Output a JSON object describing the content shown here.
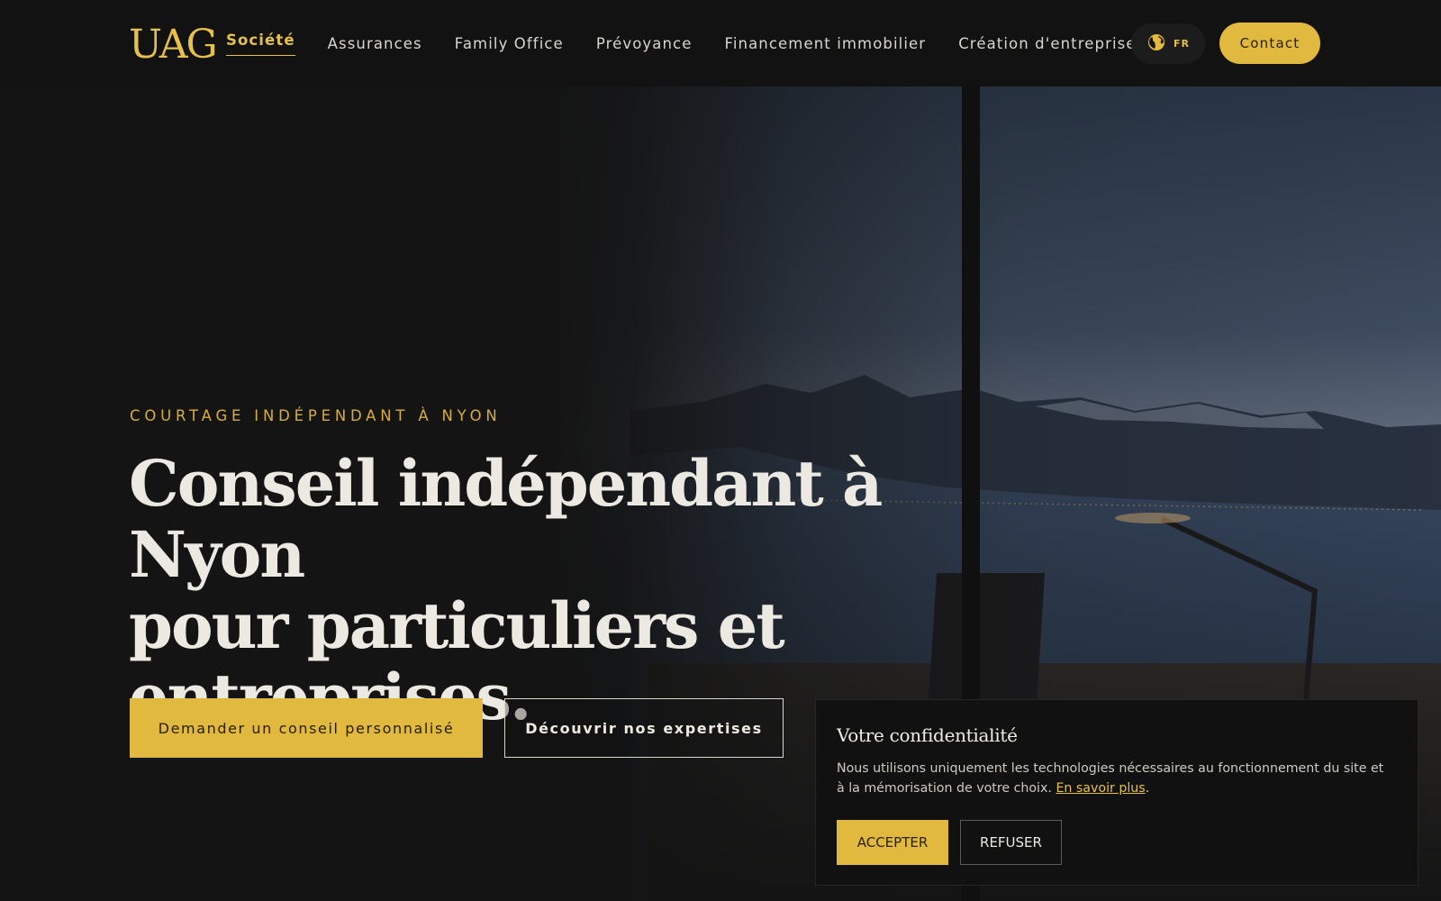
{
  "header": {
    "logo": "UAG",
    "nav": [
      {
        "label": "Société",
        "active": true
      },
      {
        "label": "Assurances",
        "active": false
      },
      {
        "label": "Family Office",
        "active": false
      },
      {
        "label": "Prévoyance",
        "active": false
      },
      {
        "label": "Financement immobilier",
        "active": false
      },
      {
        "label": "Création d'entreprise",
        "active": false
      }
    ],
    "language": {
      "icon": "globe-icon",
      "code": "FR"
    },
    "contact_label": "Contact"
  },
  "hero": {
    "kicker": "COURTAGE INDÉPENDANT À NYON",
    "headline_lines": [
      "Conseil indépendant à Nyon",
      "pour particuliers et",
      "entreprises."
    ],
    "primary_cta": "Demander un conseil personnalisé",
    "secondary_cta": "Découvrir nos expertises"
  },
  "cookie": {
    "title": "Votre confidentialité",
    "text": "Nous utilisons uniquement les technologies nécessaires au fonctionnement du site et à la mémorisation de votre choix.",
    "link": "En savoir plus",
    "after_link": ".",
    "accept": "ACCEPTER",
    "refuse": "REFUSER"
  },
  "colors": {
    "accent": "#e2b93f",
    "background": "#121212",
    "text": "#ece9e2"
  }
}
